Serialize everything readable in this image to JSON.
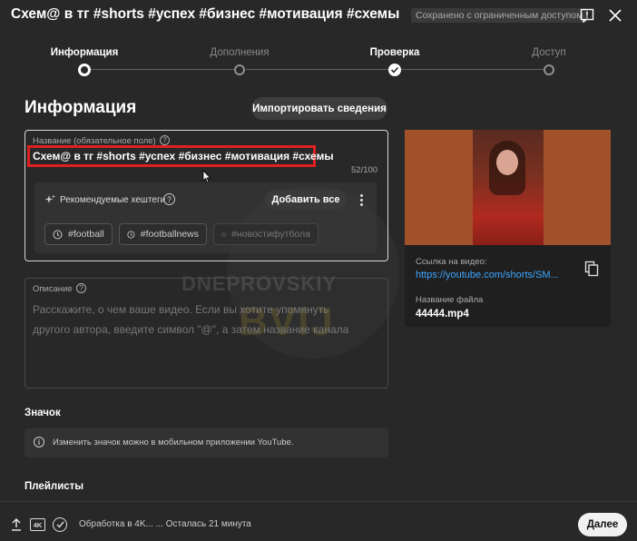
{
  "header": {
    "title": "Схем@ в тг #shorts #успех #бизнес #мотивация #схемы",
    "saved_status": "Сохранено с ограниченным доступом"
  },
  "stepper": {
    "steps": [
      {
        "label": "Информация",
        "state": "current"
      },
      {
        "label": "Дополнения",
        "state": "inactive"
      },
      {
        "label": "Проверка",
        "state": "done"
      },
      {
        "label": "Доступ",
        "state": "inactive"
      }
    ]
  },
  "info": {
    "heading": "Информация",
    "import_label": "Импортировать сведения",
    "title_field": {
      "label": "Название (обязательное поле)",
      "value": "Схем@ в тг #shorts #успех #бизнес #мотивация #схемы",
      "counter": "52/100"
    },
    "hashtags": {
      "label": "Рекомендуемые хештеги",
      "add_all_label": "Добавить все",
      "chips": [
        "#football",
        "#footballnews",
        "#новостифутбола"
      ]
    },
    "description": {
      "label": "Описание",
      "placeholder": "Расскажите, о чем ваше видео. Если вы хотите упомянуть другого автора, введите символ \"@\", а затем название канала"
    },
    "icon_section": {
      "heading": "Значок",
      "info_text": "Изменить значок можно в мобильном приложении YouTube."
    },
    "playlists_heading": "Плейлисты"
  },
  "video": {
    "link_label": "Ссылка на видео:",
    "link_value": "https://youtube.com/shorts/SM...",
    "filename_label": "Название файла",
    "filename_value": "44444.mp4"
  },
  "watermark": {
    "line1": "DNEPROVSKIY",
    "line2": "BVIJ"
  },
  "footer": {
    "quality_badge": "4K",
    "status_text": "Обработка в 4K... ... Осталась 21 минута",
    "next_label": "Далее"
  },
  "colors": {
    "accent_link": "#3ea6ff",
    "highlight_border": "#e02020",
    "background": "#282828"
  }
}
